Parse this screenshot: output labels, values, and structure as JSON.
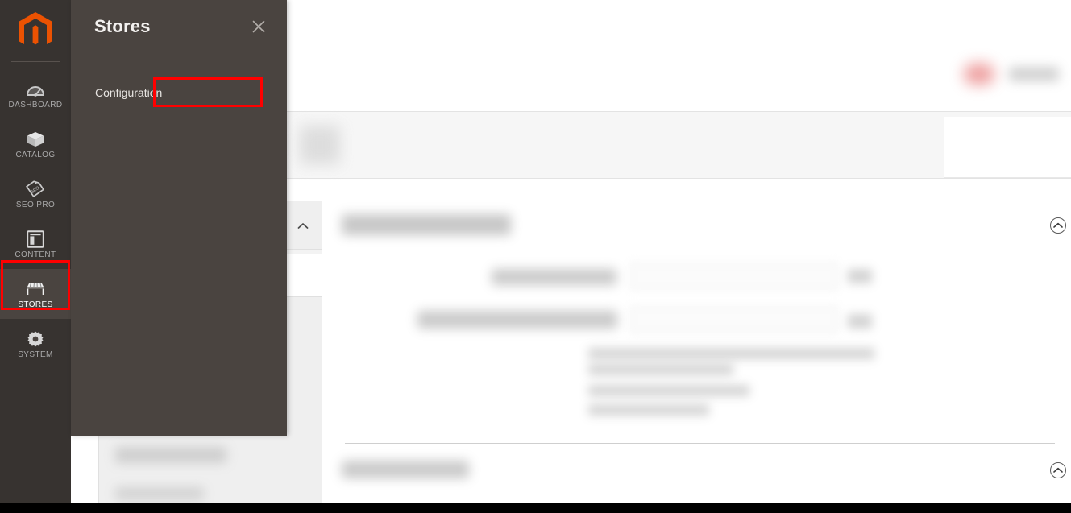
{
  "app": {
    "name": "Magento Admin",
    "logo_icon": "magento-logo-icon",
    "accent_color": "#eb5202",
    "sidebar_bg": "#373330",
    "flyout_bg": "#4a4440",
    "highlight_color": "#ff0000"
  },
  "sidebar": {
    "items": [
      {
        "label": "DASHBOARD",
        "icon": "dashboard-gauge-icon",
        "active": false,
        "highlighted": false
      },
      {
        "label": "CATALOG",
        "icon": "catalog-box-icon",
        "active": false,
        "highlighted": false
      },
      {
        "label": "SEO PRO",
        "icon": "seo-tag-icon",
        "active": false,
        "highlighted": false
      },
      {
        "label": "CONTENT",
        "icon": "content-layout-icon",
        "active": false,
        "highlighted": false
      },
      {
        "label": "STORES",
        "icon": "stores-shop-icon",
        "active": true,
        "highlighted": true
      },
      {
        "label": "SYSTEM",
        "icon": "system-gear-icon",
        "active": false,
        "highlighted": false
      }
    ]
  },
  "flyout": {
    "title": "Stores",
    "close_icon": "close-icon",
    "items": [
      {
        "label": "Configuration",
        "highlighted": true
      }
    ]
  },
  "main": {
    "collapse_toggle_icon": "chevron-up-circle-icon",
    "section_chevron_icon": "chevron-up-icon",
    "blurred": true
  },
  "bottom": {
    "strip_color": "#000000"
  }
}
